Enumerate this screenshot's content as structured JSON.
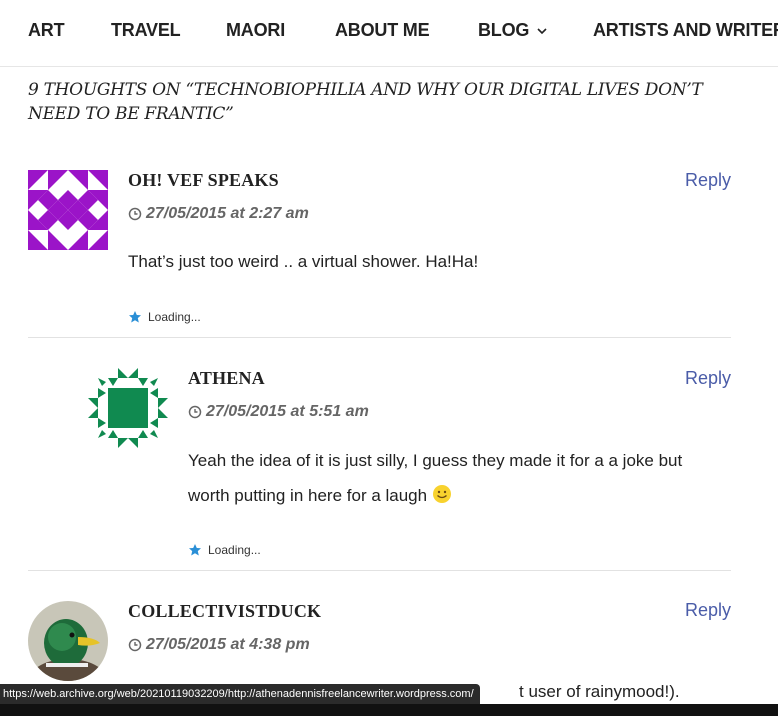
{
  "nav": {
    "items": [
      {
        "label": "ART"
      },
      {
        "label": "TRAVEL"
      },
      {
        "label": "MAORI"
      },
      {
        "label": "ABOUT ME"
      },
      {
        "label": "BLOG"
      },
      {
        "label": "ARTISTS AND WRITERS"
      }
    ]
  },
  "comments_title": "9 thoughts on “Technobiophilia and why our digital lives don’t need to be frantic”",
  "comments": [
    {
      "author": "OH! VEF SPEAKS",
      "date": "27/05/2015 at 2:27 am",
      "reply": "Reply",
      "text": "That’s just too weird .. a virtual shower. Ha!Ha!",
      "likes": "Loading..."
    },
    {
      "author": "ATHENA",
      "date": "27/05/2015 at 5:51 am",
      "reply": "Reply",
      "text_line1": "Yeah the idea of it is just silly, I guess they made it for a a joke but",
      "text_line2": "worth putting in here for a laugh",
      "likes": "Loading..."
    },
    {
      "author": "COLLECTIVISTDUCK",
      "date": "27/05/2015 at 4:38 pm",
      "reply": "Reply",
      "text_partial": "t user of rainymood!)."
    }
  ],
  "status_url": "https://web.archive.org/web/20210119032209/http://athenadennisfreelancewriter.wordpress.com/",
  "colors": {
    "reply": "#4a5ca8",
    "avatar1": "#9b14c8",
    "avatar2": "#108a50",
    "like_star": "#2a8fd6"
  }
}
